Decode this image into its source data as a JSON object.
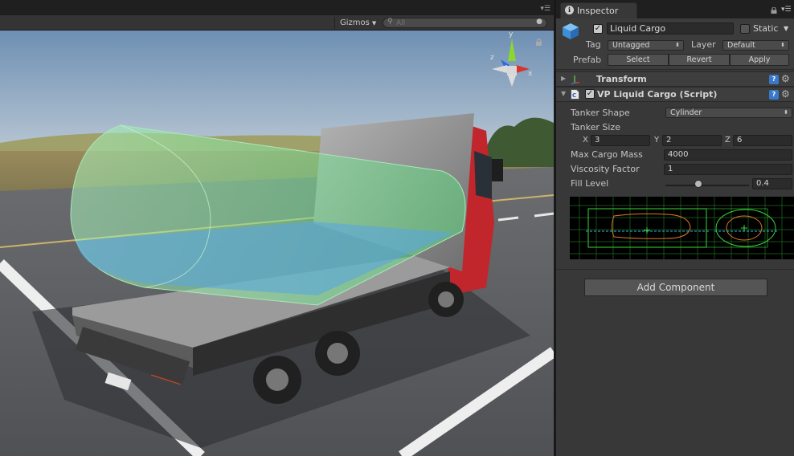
{
  "scene": {
    "gizmos_label": "Gizmos",
    "search_placeholder": "All",
    "colors": {
      "sky": "#8fa7bf",
      "road": "#575a5e",
      "truck_cab": "#c1262c",
      "cargo_fill": "#5aa6e0",
      "cargo_shell": "#78d890"
    }
  },
  "inspector": {
    "tab_label": "Inspector",
    "object": {
      "active": true,
      "name": "Liquid Cargo",
      "static_label": "Static",
      "static_checked": false,
      "tag_label": "Tag",
      "tag_value": "Untagged",
      "layer_label": "Layer",
      "layer_value": "Default",
      "prefab_label": "Prefab",
      "prefab_buttons": [
        "Select",
        "Revert",
        "Apply"
      ]
    },
    "components": {
      "transform_title": "Transform",
      "script_title": "VP Liquid Cargo (Script)",
      "script_enabled": true
    },
    "properties": {
      "tanker_shape_label": "Tanker Shape",
      "tanker_shape_value": "Cylinder",
      "tanker_size_label": "Tanker Size",
      "size": {
        "x_label": "X",
        "x": "3",
        "y_label": "Y",
        "y": "2",
        "z_label": "Z",
        "z": "6"
      },
      "max_cargo_mass_label": "Max Cargo Mass",
      "max_cargo_mass": "4000",
      "viscosity_label": "Viscosity Factor",
      "viscosity": "1",
      "fill_level_label": "Fill Level",
      "fill_level": "0.4"
    },
    "add_component_label": "Add Component"
  }
}
